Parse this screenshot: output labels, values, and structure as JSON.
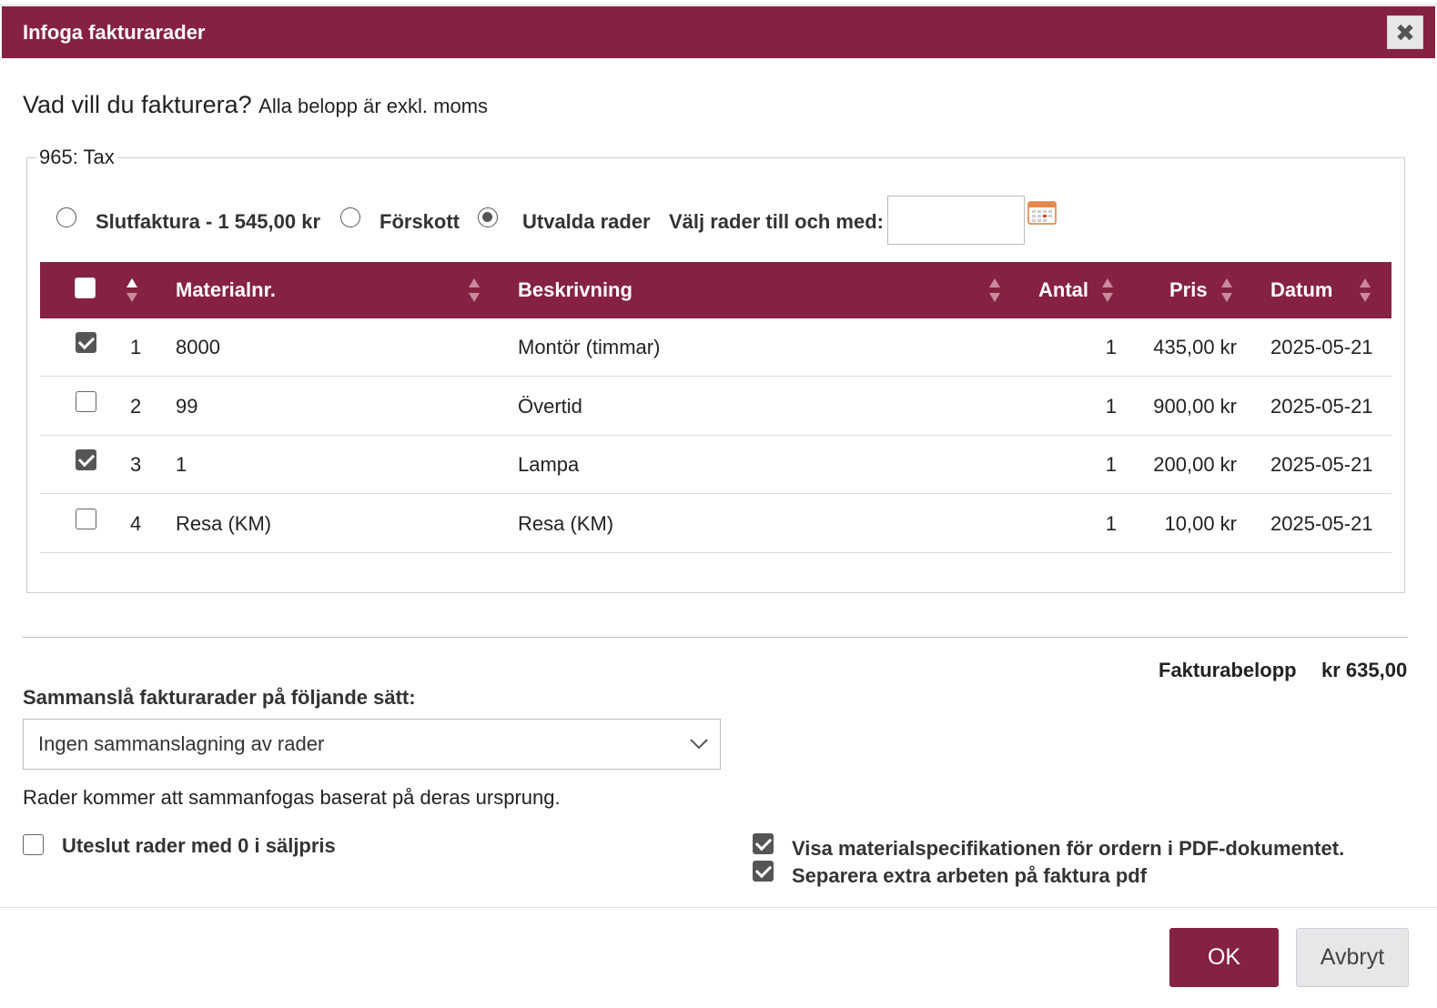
{
  "dialog": {
    "title": "Infoga fakturarader",
    "close_glyph": "✖",
    "heading": "Vad vill du fakturera?",
    "heading_sub": "Alla belopp är exkl. moms"
  },
  "group": {
    "legend": "965: Tax",
    "radios": [
      {
        "label": "Slutfaktura - 1 545,00 kr",
        "checked": false
      },
      {
        "label": "Förskott",
        "checked": false
      },
      {
        "label": "Utvalda rader",
        "checked": true
      }
    ],
    "date_label": "Välj rader till och med:",
    "date_value": "",
    "calendar_icon": "calendar-icon"
  },
  "table": {
    "columns": [
      "Materialnr.",
      "Beskrivning",
      "Antal",
      "Pris",
      "Datum"
    ],
    "rows": [
      {
        "checked": true,
        "index": "1",
        "material": "8000",
        "description": "Montör (timmar)",
        "qty": "1",
        "price": "435,00 kr",
        "date": "2025-05-21"
      },
      {
        "checked": false,
        "index": "2",
        "material": "99",
        "description": "Övertid",
        "qty": "1",
        "price": "900,00 kr",
        "date": "2025-05-21"
      },
      {
        "checked": true,
        "index": "3",
        "material": "1",
        "description": "Lampa",
        "qty": "1",
        "price": "200,00 kr",
        "date": "2025-05-21"
      },
      {
        "checked": false,
        "index": "4",
        "material": "Resa (KM)",
        "description": "Resa (KM)",
        "qty": "1",
        "price": "10,00 kr",
        "date": "2025-05-21"
      }
    ]
  },
  "summary": {
    "total_label": "Fakturabelopp",
    "total_value": "kr 635,00"
  },
  "merge": {
    "label": "Sammanslå fakturarader på följande sätt:",
    "selected": "Ingen sammanslagning av rader",
    "note": "Rader kommer att sammanfogas baserat på deras ursprung."
  },
  "options": {
    "exclude_zero": {
      "label": "Uteslut rader med 0 i säljpris",
      "checked": false
    },
    "show_material_spec": {
      "label": "Visa materialspecifikationen för ordern i PDF-dokumentet.",
      "checked": true
    },
    "separate_extra": {
      "label": "Separera extra arbeten på faktura pdf",
      "checked": true
    }
  },
  "buttons": {
    "ok": "OK",
    "cancel": "Avbryt"
  },
  "colors": {
    "accent": "#862241",
    "checkbox_checked": "#555555"
  }
}
